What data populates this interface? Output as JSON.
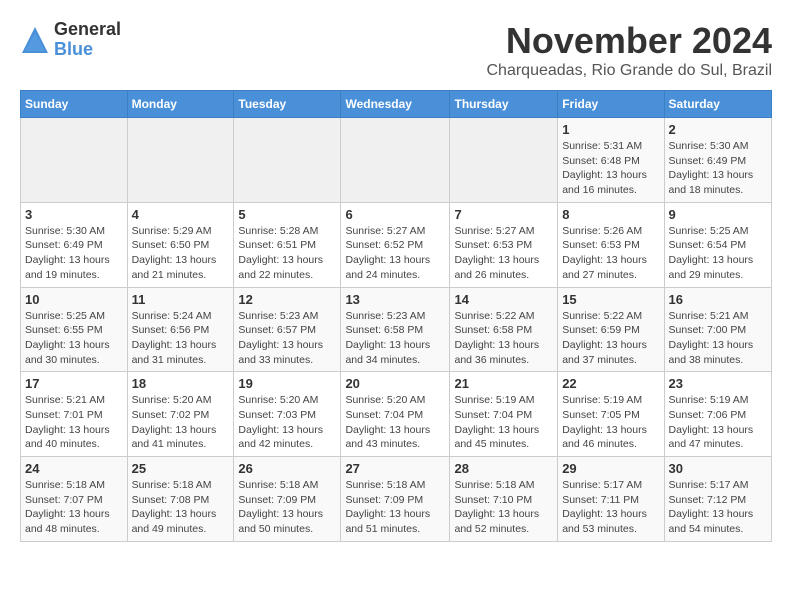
{
  "logo": {
    "general": "General",
    "blue": "Blue"
  },
  "title": "November 2024",
  "location": "Charqueadas, Rio Grande do Sul, Brazil",
  "days_of_week": [
    "Sunday",
    "Monday",
    "Tuesday",
    "Wednesday",
    "Thursday",
    "Friday",
    "Saturday"
  ],
  "weeks": [
    [
      {
        "day": "",
        "info": ""
      },
      {
        "day": "",
        "info": ""
      },
      {
        "day": "",
        "info": ""
      },
      {
        "day": "",
        "info": ""
      },
      {
        "day": "",
        "info": ""
      },
      {
        "day": "1",
        "info": "Sunrise: 5:31 AM\nSunset: 6:48 PM\nDaylight: 13 hours\nand 16 minutes."
      },
      {
        "day": "2",
        "info": "Sunrise: 5:30 AM\nSunset: 6:49 PM\nDaylight: 13 hours\nand 18 minutes."
      }
    ],
    [
      {
        "day": "3",
        "info": "Sunrise: 5:30 AM\nSunset: 6:49 PM\nDaylight: 13 hours\nand 19 minutes."
      },
      {
        "day": "4",
        "info": "Sunrise: 5:29 AM\nSunset: 6:50 PM\nDaylight: 13 hours\nand 21 minutes."
      },
      {
        "day": "5",
        "info": "Sunrise: 5:28 AM\nSunset: 6:51 PM\nDaylight: 13 hours\nand 22 minutes."
      },
      {
        "day": "6",
        "info": "Sunrise: 5:27 AM\nSunset: 6:52 PM\nDaylight: 13 hours\nand 24 minutes."
      },
      {
        "day": "7",
        "info": "Sunrise: 5:27 AM\nSunset: 6:53 PM\nDaylight: 13 hours\nand 26 minutes."
      },
      {
        "day": "8",
        "info": "Sunrise: 5:26 AM\nSunset: 6:53 PM\nDaylight: 13 hours\nand 27 minutes."
      },
      {
        "day": "9",
        "info": "Sunrise: 5:25 AM\nSunset: 6:54 PM\nDaylight: 13 hours\nand 29 minutes."
      }
    ],
    [
      {
        "day": "10",
        "info": "Sunrise: 5:25 AM\nSunset: 6:55 PM\nDaylight: 13 hours\nand 30 minutes."
      },
      {
        "day": "11",
        "info": "Sunrise: 5:24 AM\nSunset: 6:56 PM\nDaylight: 13 hours\nand 31 minutes."
      },
      {
        "day": "12",
        "info": "Sunrise: 5:23 AM\nSunset: 6:57 PM\nDaylight: 13 hours\nand 33 minutes."
      },
      {
        "day": "13",
        "info": "Sunrise: 5:23 AM\nSunset: 6:58 PM\nDaylight: 13 hours\nand 34 minutes."
      },
      {
        "day": "14",
        "info": "Sunrise: 5:22 AM\nSunset: 6:58 PM\nDaylight: 13 hours\nand 36 minutes."
      },
      {
        "day": "15",
        "info": "Sunrise: 5:22 AM\nSunset: 6:59 PM\nDaylight: 13 hours\nand 37 minutes."
      },
      {
        "day": "16",
        "info": "Sunrise: 5:21 AM\nSunset: 7:00 PM\nDaylight: 13 hours\nand 38 minutes."
      }
    ],
    [
      {
        "day": "17",
        "info": "Sunrise: 5:21 AM\nSunset: 7:01 PM\nDaylight: 13 hours\nand 40 minutes."
      },
      {
        "day": "18",
        "info": "Sunrise: 5:20 AM\nSunset: 7:02 PM\nDaylight: 13 hours\nand 41 minutes."
      },
      {
        "day": "19",
        "info": "Sunrise: 5:20 AM\nSunset: 7:03 PM\nDaylight: 13 hours\nand 42 minutes."
      },
      {
        "day": "20",
        "info": "Sunrise: 5:20 AM\nSunset: 7:04 PM\nDaylight: 13 hours\nand 43 minutes."
      },
      {
        "day": "21",
        "info": "Sunrise: 5:19 AM\nSunset: 7:04 PM\nDaylight: 13 hours\nand 45 minutes."
      },
      {
        "day": "22",
        "info": "Sunrise: 5:19 AM\nSunset: 7:05 PM\nDaylight: 13 hours\nand 46 minutes."
      },
      {
        "day": "23",
        "info": "Sunrise: 5:19 AM\nSunset: 7:06 PM\nDaylight: 13 hours\nand 47 minutes."
      }
    ],
    [
      {
        "day": "24",
        "info": "Sunrise: 5:18 AM\nSunset: 7:07 PM\nDaylight: 13 hours\nand 48 minutes."
      },
      {
        "day": "25",
        "info": "Sunrise: 5:18 AM\nSunset: 7:08 PM\nDaylight: 13 hours\nand 49 minutes."
      },
      {
        "day": "26",
        "info": "Sunrise: 5:18 AM\nSunset: 7:09 PM\nDaylight: 13 hours\nand 50 minutes."
      },
      {
        "day": "27",
        "info": "Sunrise: 5:18 AM\nSunset: 7:09 PM\nDaylight: 13 hours\nand 51 minutes."
      },
      {
        "day": "28",
        "info": "Sunrise: 5:18 AM\nSunset: 7:10 PM\nDaylight: 13 hours\nand 52 minutes."
      },
      {
        "day": "29",
        "info": "Sunrise: 5:17 AM\nSunset: 7:11 PM\nDaylight: 13 hours\nand 53 minutes."
      },
      {
        "day": "30",
        "info": "Sunrise: 5:17 AM\nSunset: 7:12 PM\nDaylight: 13 hours\nand 54 minutes."
      }
    ]
  ]
}
